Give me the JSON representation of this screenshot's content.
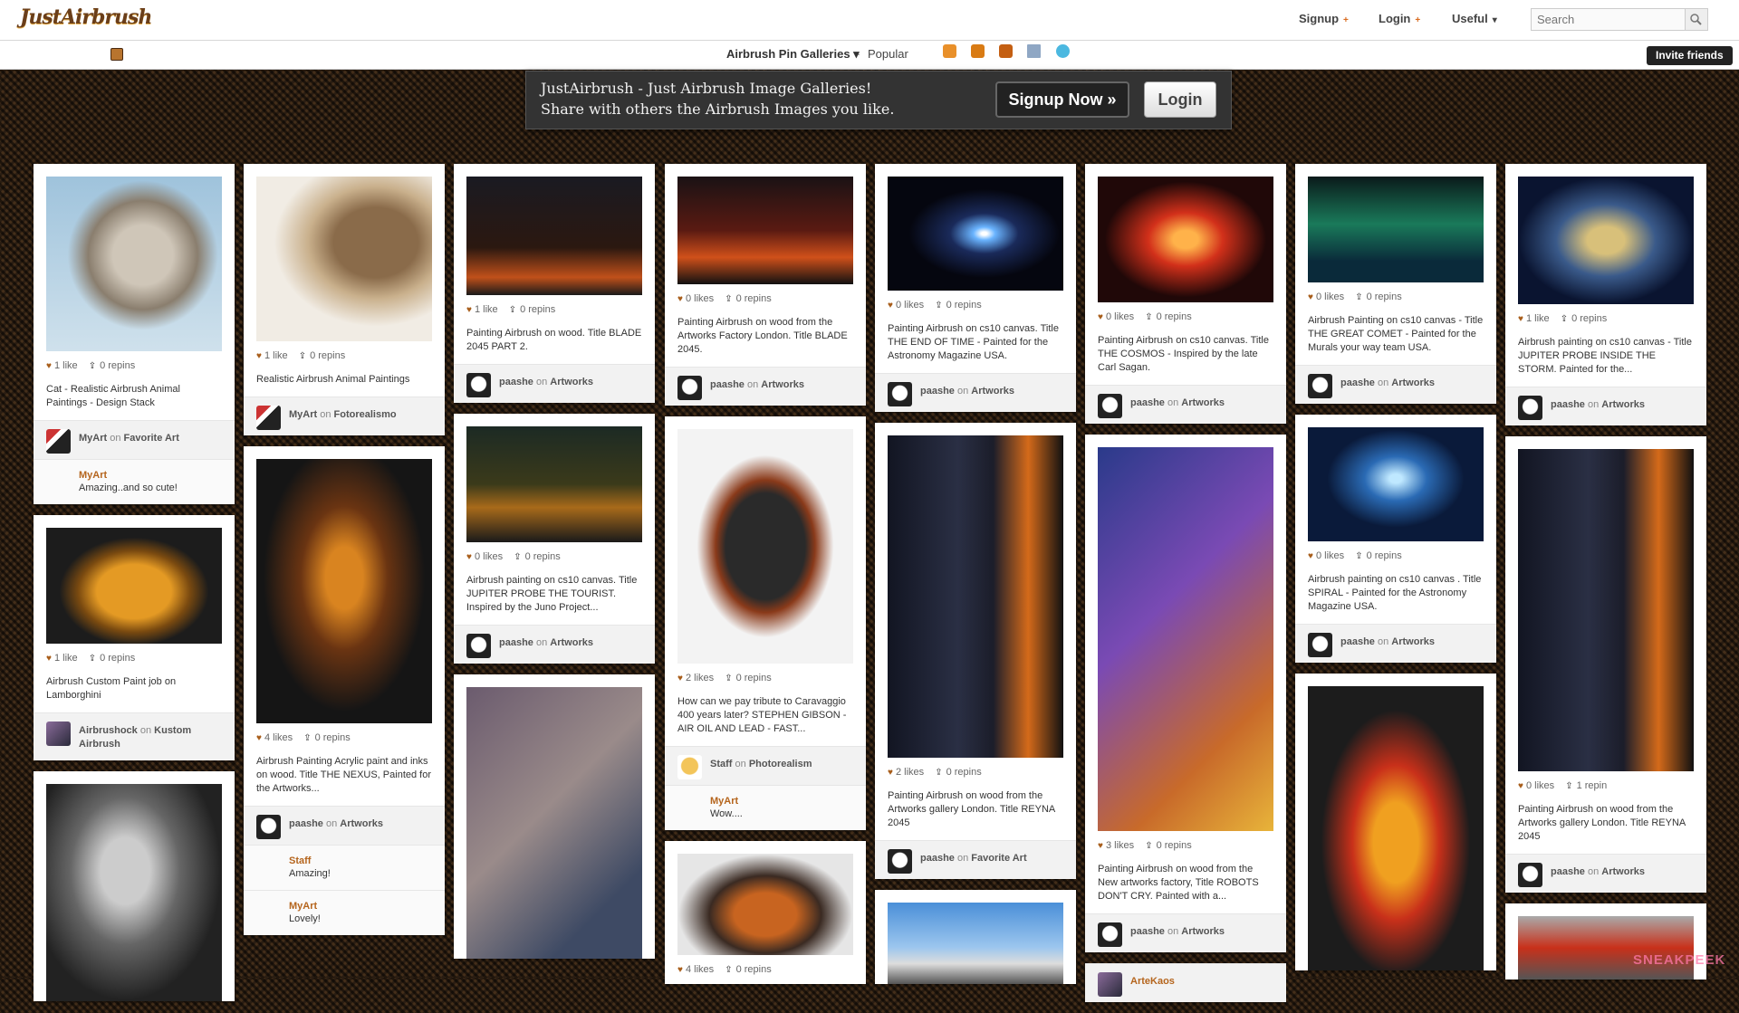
{
  "header": {
    "logo": "JustAirbrush",
    "menu": [
      {
        "label": "Signup",
        "marker": "+"
      },
      {
        "label": "Login",
        "marker": "+"
      },
      {
        "label": "Useful",
        "marker": "▾"
      }
    ],
    "search_placeholder": "Search",
    "search_icon": "magnifier-icon"
  },
  "subbar": {
    "gallery_label": "Airbrush Pin Galleries",
    "popular": "Popular",
    "icons": [
      "rss-icon",
      "bookmark-icon",
      "facebook-icon",
      "page-icon",
      "twitter-icon"
    ],
    "invite": "Invite friends"
  },
  "banner": {
    "line1": "JustAirbrush - Just Airbrush Image Galleries!",
    "line2": "Share with others the Airbrush Images you like.",
    "signup": "Signup Now »",
    "login": "Login"
  },
  "columns": [
    [
      {
        "likes": "1 like",
        "repins": "0 repins",
        "desc": "Cat - Realistic Airbrush Animal Paintings - Design Stack",
        "user": "MyArt",
        "board": "Favorite Art",
        "av": "myart",
        "img": "cat1",
        "comments": [
          {
            "who": "MyArt",
            "text": "Amazing..and so cute!",
            "av": "myart"
          }
        ]
      },
      {
        "likes": "1 like",
        "repins": "0 repins",
        "desc": "Airbrush Custom Paint job on Lamborghini",
        "user": "Airbrushock",
        "board": "Kustom Airbrush",
        "av": "photo",
        "img": "lambo",
        "comments": []
      },
      {
        "likes": "",
        "repins": "",
        "desc": "",
        "user": "",
        "board": "",
        "av": "",
        "img": "gothic",
        "comments": []
      }
    ],
    [
      {
        "likes": "1 like",
        "repins": "0 repins",
        "desc": "Realistic Airbrush Animal Paintings",
        "user": "MyArt",
        "board": "Fotorealismo",
        "av": "myart",
        "img": "cat2",
        "comments": []
      },
      {
        "likes": "4 likes",
        "repins": "0 repins",
        "desc": "Airbrush Painting Acrylic paint and inks on wood. Title THE NEXUS, Painted for the Artworks...",
        "user": "paashe",
        "board": "Artworks",
        "av": "skull",
        "img": "nexus",
        "comments": [
          {
            "who": "Staff",
            "text": "Amazing!",
            "av": "staff"
          },
          {
            "who": "MyArt",
            "text": "Lovely!",
            "av": "myart"
          }
        ]
      }
    ],
    [
      {
        "likes": "1 like",
        "repins": "0 repins",
        "desc": "Painting Airbrush on wood. Title BLADE 2045 PART 2.",
        "user": "paashe",
        "board": "Artworks",
        "av": "skull",
        "img": "blade2",
        "comments": []
      },
      {
        "likes": "0 likes",
        "repins": "0 repins",
        "desc": "Airbrush painting on cs10 canvas. Title JUPITER PROBE THE TOURIST. Inspired by the Juno Project...",
        "user": "paashe",
        "board": "Artworks",
        "av": "skull",
        "img": "jupiter",
        "comments": []
      },
      {
        "likes": "",
        "repins": "",
        "desc": "",
        "user": "",
        "board": "",
        "av": "",
        "img": "face",
        "comments": []
      }
    ],
    [
      {
        "likes": "0 likes",
        "repins": "0 repins",
        "desc": "Painting Airbrush on wood from the Artworks Factory London. Title BLADE 2045.",
        "user": "paashe",
        "board": "Artworks",
        "av": "skull",
        "img": "blade",
        "comments": []
      },
      {
        "likes": "2 likes",
        "repins": "0 repins",
        "desc": "How can we pay tribute to Caravaggio 400 years later? STEPHEN GIBSON - AIR OIL AND LEAD - FAST...",
        "user": "Staff",
        "board": "Photorealism",
        "av": "staff",
        "img": "tank",
        "comments": [
          {
            "who": "MyArt",
            "text": "Wow....",
            "av": "myart"
          }
        ]
      },
      {
        "likes": "4 likes",
        "repins": "0 repins",
        "desc": "",
        "user": "",
        "board": "",
        "av": "",
        "img": "car2",
        "comments": []
      }
    ],
    [
      {
        "likes": "0 likes",
        "repins": "0 repins",
        "desc": "Painting Airbrush on cs10 canvas. Title THE END OF TIME - Painted for the Astronomy Magazine USA.",
        "user": "paashe",
        "board": "Artworks",
        "av": "skull",
        "img": "galaxy",
        "comments": []
      },
      {
        "likes": "2 likes",
        "repins": "0 repins",
        "desc": "Painting Airbrush on wood from the Artworks gallery London. Title REYNA 2045",
        "user": "paashe",
        "board": "Favorite Art",
        "av": "skull",
        "img": "reyna",
        "comments": []
      },
      {
        "likes": "",
        "repins": "",
        "desc": "",
        "user": "",
        "board": "",
        "av": "",
        "img": "truck",
        "comments": []
      }
    ],
    [
      {
        "likes": "0 likes",
        "repins": "0 repins",
        "desc": "Painting Airbrush on cs10 canvas. Title THE COSMOS - Inspired by the late Carl Sagan.",
        "user": "paashe",
        "board": "Artworks",
        "av": "skull",
        "img": "cosmos",
        "comments": []
      },
      {
        "likes": "3 likes",
        "repins": "0 repins",
        "desc": "Painting Airbrush on wood from the New artworks factory, Title ROBOTS DON'T CRY. Painted with a...",
        "user": "paashe",
        "board": "Artworks",
        "av": "skull",
        "img": "robot",
        "comments": []
      },
      {
        "likes": "",
        "repins": "",
        "desc": "",
        "user": "ArteKaos",
        "board": "",
        "av": "photo",
        "img": "",
        "comments": []
      }
    ],
    [
      {
        "likes": "0 likes",
        "repins": "0 repins",
        "desc": "Airbrush Painting on cs10 canvas - Title THE GREAT COMET - Painted for the Murals your way team USA.",
        "user": "paashe",
        "board": "Artworks",
        "av": "skull",
        "img": "comet",
        "comments": []
      },
      {
        "likes": "0 likes",
        "repins": "0 repins",
        "desc": "Airbrush painting on cs10 canvas . Title SPIRAL - Painted for the Astronomy Magazine USA.",
        "user": "paashe",
        "board": "Artworks",
        "av": "skull",
        "img": "spiral",
        "comments": []
      },
      {
        "likes": "",
        "repins": "",
        "desc": "",
        "user": "",
        "board": "",
        "av": "",
        "img": "flamecar",
        "comments": []
      }
    ],
    [
      {
        "likes": "1 like",
        "repins": "0 repins",
        "desc": "Airbrush painting on cs10 canvas - Title JUPITER PROBE INSIDE THE STORM. Painted for the...",
        "user": "paashe",
        "board": "Artworks",
        "av": "skull",
        "img": "storm",
        "comments": []
      },
      {
        "likes": "0 likes",
        "repins": "1 repin",
        "desc": "Painting Airbrush on wood from the Artworks gallery London. Title REYNA 2045",
        "user": "paashe",
        "board": "Artworks",
        "av": "skull",
        "img": "reyna",
        "comments": []
      },
      {
        "likes": "",
        "repins": "",
        "desc": "",
        "user": "",
        "board": "",
        "av": "",
        "img": "engine",
        "comments": []
      }
    ]
  ],
  "watermark": "SNEAKPEEK"
}
